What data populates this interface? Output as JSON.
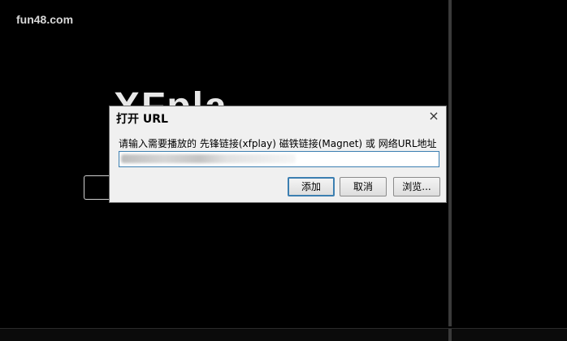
{
  "watermark": "fun48.com",
  "background": {
    "logo_text": "XFplay"
  },
  "dialog": {
    "title": "打开 URL",
    "close_glyph": "×",
    "prompt": "请输入需要播放的 先锋链接(xfplay) 磁铁链接(Magnet) 或 网络URL地址",
    "url_value": "",
    "buttons": {
      "add": "添加",
      "cancel": "取消",
      "browse": "浏览..."
    }
  },
  "colors": {
    "background": "#000000",
    "dialog_bg": "#f0f0f0",
    "focus_border": "#3c7fb1"
  }
}
